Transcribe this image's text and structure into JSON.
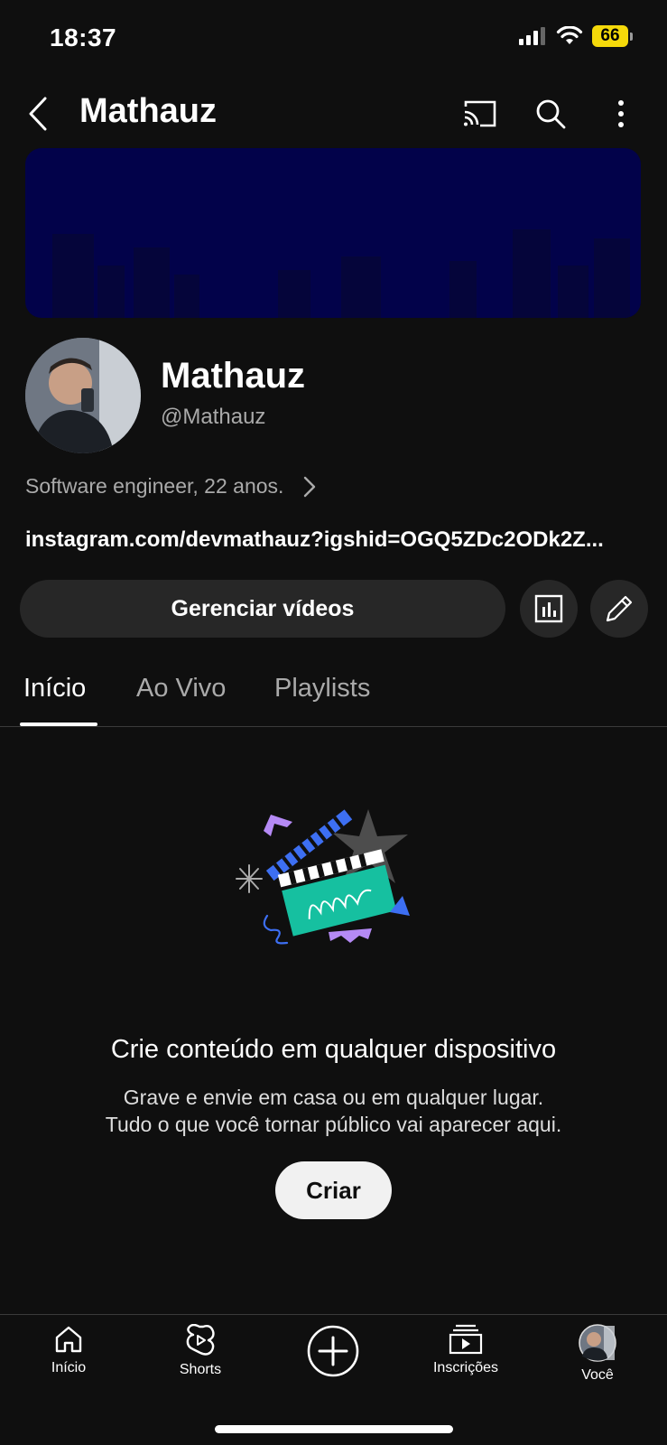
{
  "status_bar": {
    "time": "18:37",
    "battery": "66"
  },
  "header": {
    "title": "Mathauz"
  },
  "channel": {
    "name": "Mathauz",
    "handle": "@Mathauz",
    "about": "Software engineer, 22 anos.",
    "link": "instagram.com/devmathauz?igshid=OGQ5ZDc2ODk2Z..."
  },
  "actions": {
    "manage_label": "Gerenciar vídeos"
  },
  "tabs": [
    {
      "label": "Início",
      "active": true
    },
    {
      "label": "Ao Vivo",
      "active": false
    },
    {
      "label": "Playlists",
      "active": false
    }
  ],
  "empty_state": {
    "title": "Crie conteúdo em qualquer dispositivo",
    "line1": "Grave e envie em casa ou em qualquer lugar.",
    "line2": "Tudo o que você tornar público vai aparecer aqui.",
    "button_label": "Criar"
  },
  "bottom_nav": [
    {
      "label": "Início",
      "icon": "home-icon"
    },
    {
      "label": "Shorts",
      "icon": "shorts-icon"
    },
    {
      "label": "",
      "icon": "create-plus-icon"
    },
    {
      "label": "Inscrições",
      "icon": "subscriptions-icon"
    },
    {
      "label": "Você",
      "icon": "avatar"
    }
  ],
  "colors": {
    "background": "#0f0f0f",
    "banner": "#02024a",
    "button_bg": "#272727",
    "battery": "#f5d90a",
    "illustration_teal": "#16c0a0",
    "illustration_blue": "#3d6ff2",
    "illustration_purple": "#b58af5"
  }
}
